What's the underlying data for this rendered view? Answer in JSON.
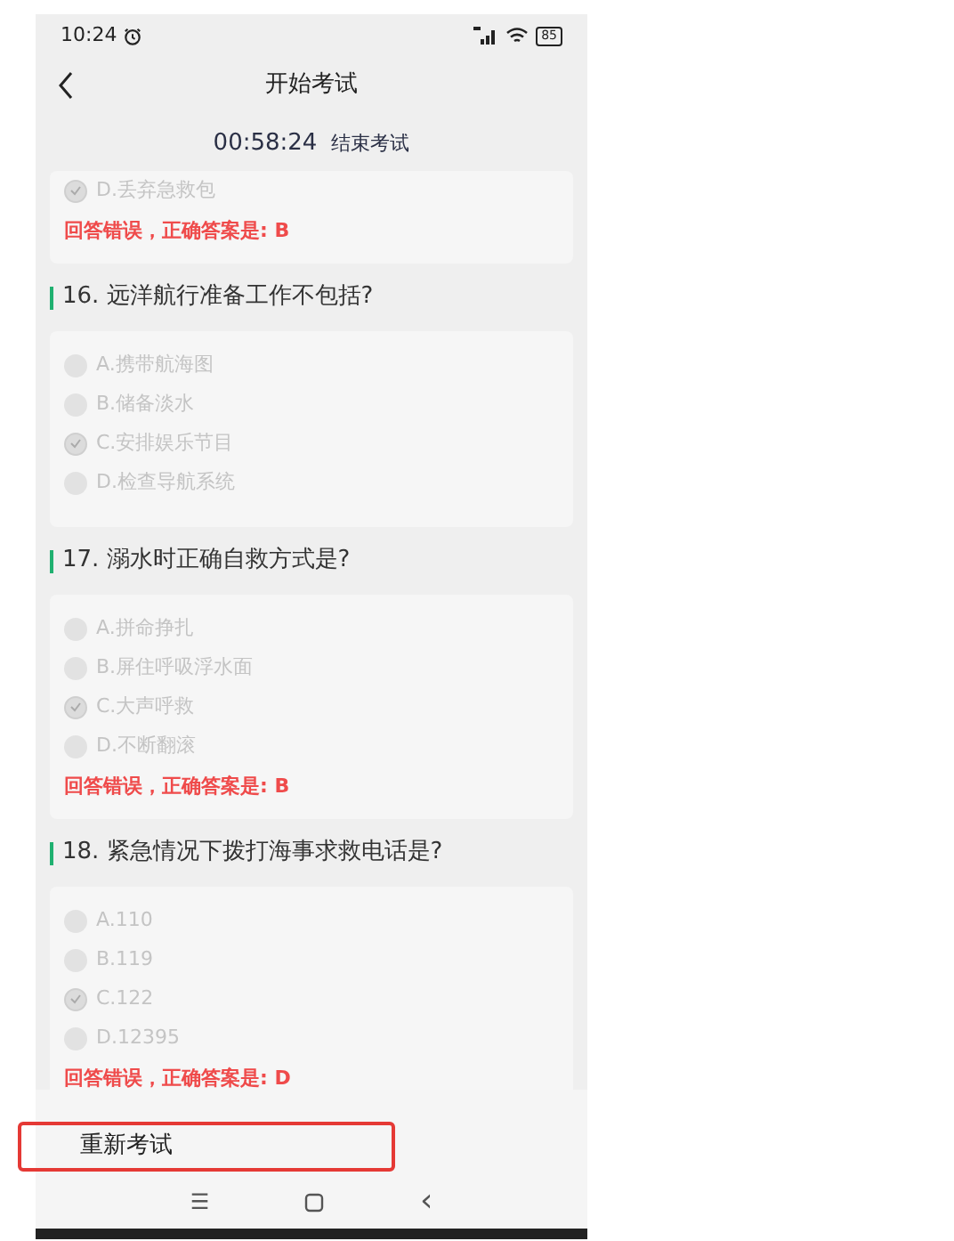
{
  "status_bar": {
    "time": "10:24",
    "battery": "85"
  },
  "header": {
    "title": "开始考试"
  },
  "timer": {
    "time": "00:58:24",
    "end_label": "结束考试"
  },
  "questions": [
    {
      "options": [
        {
          "label": "D.丢弃急救包",
          "checked": true
        }
      ],
      "feedback": "回答错误，正确答案是: B"
    },
    {
      "title": "16. 远洋航行准备工作不包括?",
      "options": [
        {
          "label": "A.携带航海图",
          "checked": false
        },
        {
          "label": "B.储备淡水",
          "checked": false
        },
        {
          "label": "C.安排娱乐节目",
          "checked": true
        },
        {
          "label": "D.检查导航系统",
          "checked": false
        }
      ]
    },
    {
      "title": "17. 溺水时正确自救方式是?",
      "options": [
        {
          "label": "A.拼命挣扎",
          "checked": false
        },
        {
          "label": "B.屏住呼吸浮水面",
          "checked": false
        },
        {
          "label": "C.大声呼救",
          "checked": true
        },
        {
          "label": "D.不断翻滚",
          "checked": false
        }
      ],
      "feedback": "回答错误，正确答案是: B"
    },
    {
      "title": "18. 紧急情况下拨打海事求救电话是?",
      "options": [
        {
          "label": "A.110",
          "checked": false
        },
        {
          "label": "B.119",
          "checked": false
        },
        {
          "label": "C.122",
          "checked": true
        },
        {
          "label": "D.12395",
          "checked": false
        }
      ],
      "feedback": "回答错误，正确答案是: D"
    }
  ],
  "retry_button": "重新考试",
  "nav_bar": {
    "menu": "☰",
    "back": "‹"
  }
}
